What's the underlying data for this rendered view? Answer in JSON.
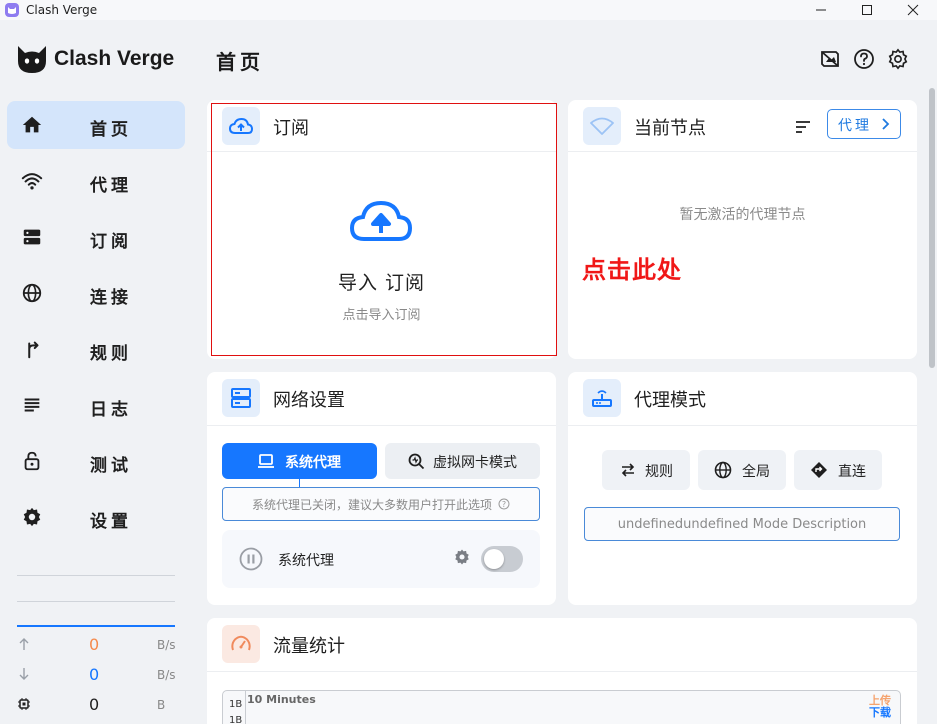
{
  "window": {
    "title": "Clash Verge"
  },
  "sidebar": {
    "logo_text": "Clash Verge",
    "items": [
      {
        "label": "首页",
        "icon": "home-icon",
        "active": true
      },
      {
        "label": "代理",
        "icon": "wifi-icon",
        "active": false
      },
      {
        "label": "订阅",
        "icon": "storage-icon",
        "active": false
      },
      {
        "label": "连接",
        "icon": "globe-icon",
        "active": false
      },
      {
        "label": "规则",
        "icon": "fork-arrow-icon",
        "active": false
      },
      {
        "label": "日志",
        "icon": "list-lines-icon",
        "active": false
      },
      {
        "label": "测试",
        "icon": "lock-icon",
        "active": false
      },
      {
        "label": "设置",
        "icon": "gear-icon",
        "active": false
      }
    ],
    "traffic": {
      "upload": {
        "value": "0",
        "unit": "B/s",
        "color": "#f58a4c"
      },
      "download": {
        "value": "0",
        "unit": "B/s",
        "color": "#1677ff"
      },
      "memory": {
        "value": "0",
        "unit": "B"
      }
    }
  },
  "header": {
    "title": "首页",
    "icons": [
      "wallpaper-icon",
      "help-circle-icon",
      "gear-icon"
    ]
  },
  "subscription_card": {
    "title": "订阅",
    "import_title": "导入 订阅",
    "import_subtitle": "点击导入订阅"
  },
  "current_node_card": {
    "title": "当前节点",
    "proxy_button": "代理",
    "empty_text": "暂无激活的代理节点"
  },
  "annotation": {
    "click_here": "点击此处",
    "color": "#f01818"
  },
  "network_card": {
    "title": "网络设置",
    "tabs": [
      {
        "label": "系统代理",
        "active": true
      },
      {
        "label": "虚拟网卡模式",
        "active": false
      }
    ],
    "description": "系统代理已关闭，建议大多数用户打开此选项",
    "toggle_label": "系统代理",
    "toggle_on": false
  },
  "proxy_mode_card": {
    "title": "代理模式",
    "modes": [
      {
        "label": "规则"
      },
      {
        "label": "全局"
      },
      {
        "label": "直连"
      }
    ],
    "description": "undefinedundefined Mode Description"
  },
  "traffic_card": {
    "title": "流量统计",
    "range_label": "10 Minutes",
    "y_tick": "1B",
    "legend_upload": "上传",
    "legend_download": "下载"
  },
  "colors": {
    "accent": "#1677ff",
    "active_nav": "#d4e5fb"
  }
}
